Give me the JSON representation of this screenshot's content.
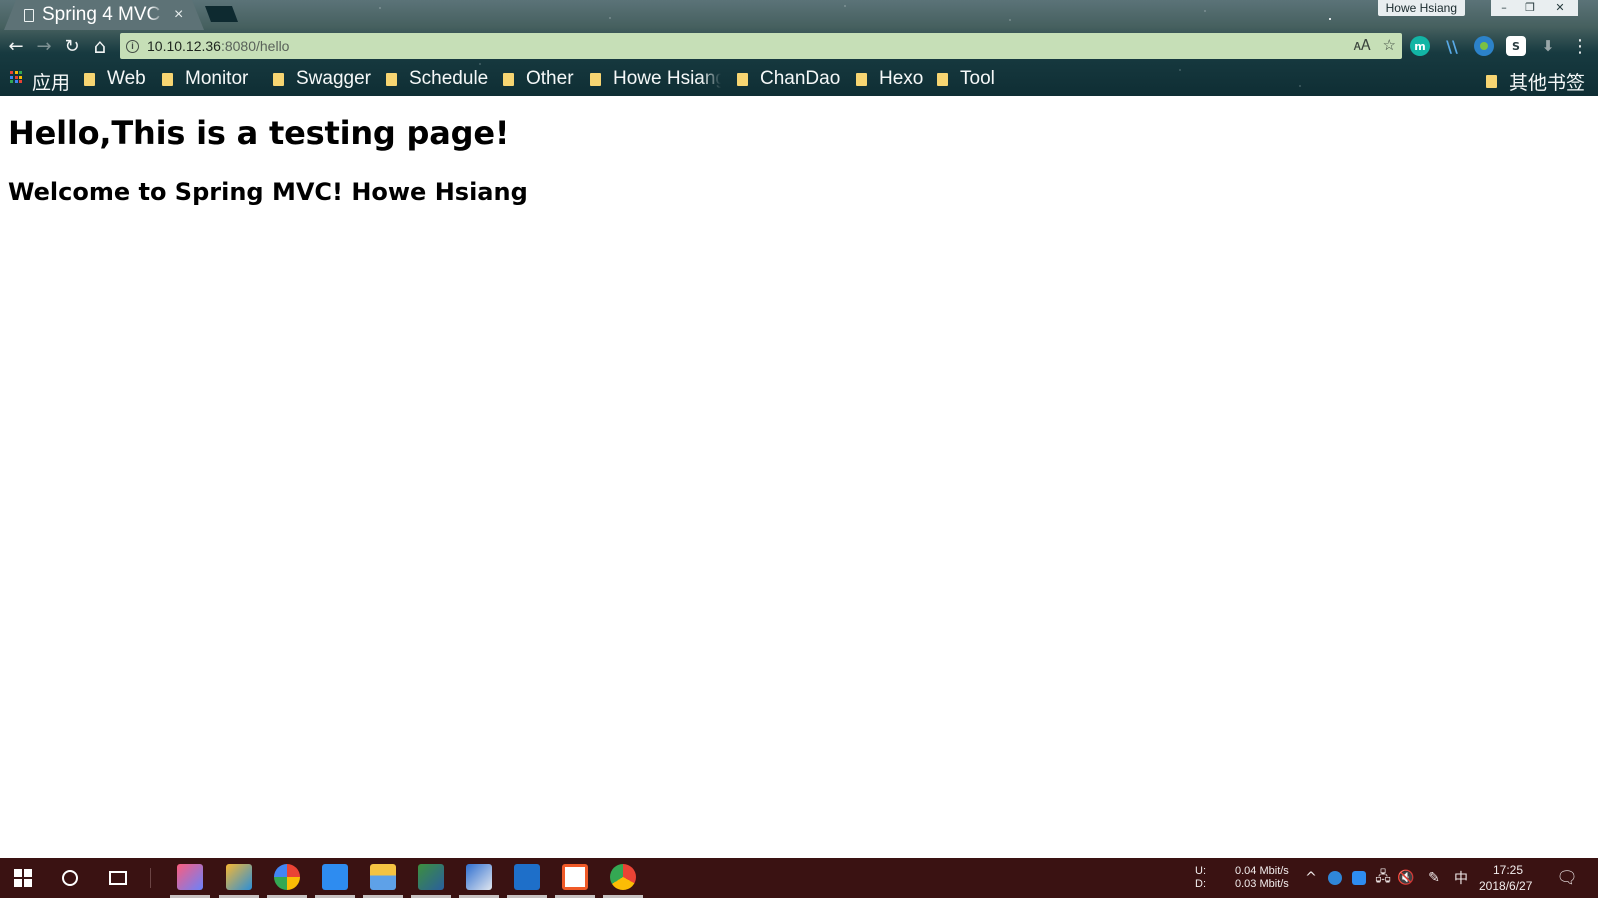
{
  "browser": {
    "tab": {
      "title": "Spring 4 MVC",
      "close": "×"
    },
    "profile_name": "Howe Hsiang",
    "window_controls": {
      "minimize": "–",
      "restore": "❐",
      "close": "✕"
    },
    "toolbar": {
      "back": "←",
      "forward": "→",
      "reload": "↻",
      "home": "⌂",
      "url_host": "10.10.12.36",
      "url_rest": ":8080/hello",
      "translate": "🗚",
      "star": "☆",
      "menu": "⋮"
    },
    "extensions": [
      {
        "name": "m-extension-icon",
        "glyph": "m",
        "color": "#12b5a5"
      },
      {
        "name": "slash-extension-icon",
        "glyph": "\\\\",
        "color": "transparent"
      },
      {
        "name": "globe-extension-icon",
        "glyph": "●",
        "color": "#2c82c9"
      },
      {
        "name": "s-extension-icon",
        "glyph": "S",
        "color": "#ffffff"
      },
      {
        "name": "download-extension-icon",
        "glyph": "⬇",
        "color": "transparent"
      }
    ],
    "bookmarks": {
      "apps_label": "应用",
      "items": [
        "Web",
        "Monitor",
        "Swagger",
        "Schedule",
        "Other",
        "Howe Hsiang",
        "ChanDao",
        "Hexo",
        "Tool"
      ],
      "other_label": "其他书签"
    }
  },
  "page": {
    "heading": "Hello,This is a testing page!",
    "subheading": "Welcome to Spring MVC! Howe Hsiang"
  },
  "taskbar": {
    "network_up_label": "U:",
    "network_down_label": "D:",
    "network_up": "0.04 Mbit/s",
    "network_down": "0.03 Mbit/s",
    "ime": "中",
    "time": "17:25",
    "date": "2018/6/27"
  }
}
